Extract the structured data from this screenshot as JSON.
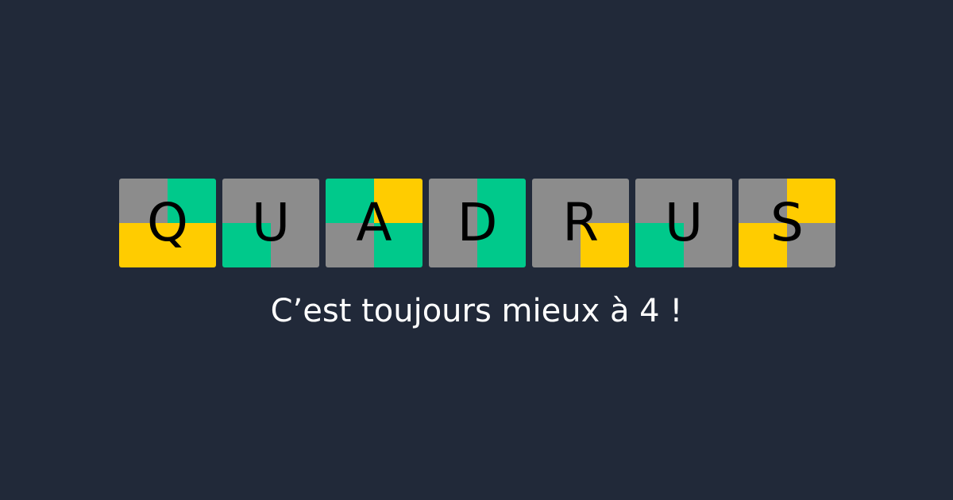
{
  "colors": {
    "background": "#212939",
    "grey": "#8c8c8c",
    "green": "#00c98b",
    "yellow": "#ffcc00",
    "letter": "#000000",
    "tagline": "#ffffff"
  },
  "logo": {
    "tiles": [
      {
        "letter": "Q",
        "quadrants": [
          "grey",
          "green",
          "yellow",
          "yellow"
        ]
      },
      {
        "letter": "U",
        "quadrants": [
          "grey",
          "grey",
          "green",
          "grey"
        ]
      },
      {
        "letter": "A",
        "quadrants": [
          "green",
          "yellow",
          "grey",
          "green"
        ]
      },
      {
        "letter": "D",
        "quadrants": [
          "grey",
          "green",
          "grey",
          "green"
        ]
      },
      {
        "letter": "R",
        "quadrants": [
          "grey",
          "grey",
          "grey",
          "yellow"
        ]
      },
      {
        "letter": "U",
        "quadrants": [
          "grey",
          "grey",
          "green",
          "grey"
        ]
      },
      {
        "letter": "S",
        "quadrants": [
          "grey",
          "yellow",
          "yellow",
          "grey"
        ]
      }
    ]
  },
  "tagline": "C’est toujours mieux à 4 !"
}
